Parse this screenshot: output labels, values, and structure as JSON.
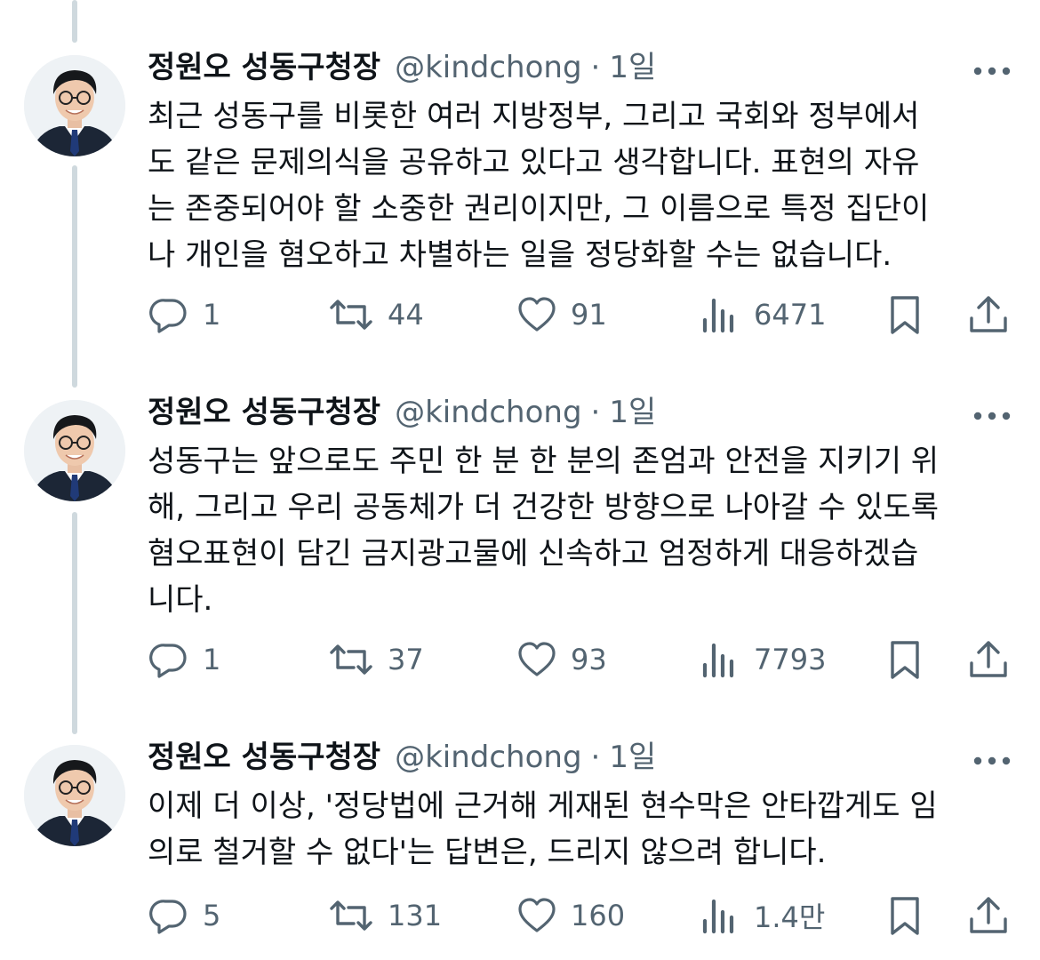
{
  "author": {
    "name": "정원오 성동구청장",
    "handle": "@kindchong",
    "dot": "·",
    "time": "1일"
  },
  "tweets": [
    {
      "lines": [
        "최근 성동구를 비롯한 여러 지방정부, 그리고 국회와 정부에서",
        "도 같은 문제의식을 공유하고 있다고 생각합니다. 표현의 자유",
        "는 존중되어야 할 소중한 권리이지만, 그 이름으로 특정 집단이",
        "나 개인을 혐오하고 차별하는 일을 정당화할 수는 없습니다."
      ],
      "replies": "1",
      "retweets": "44",
      "likes": "91",
      "views": "6471"
    },
    {
      "lines": [
        "성동구는 앞으로도 주민 한 분 한 분의 존엄과 안전을 지키기 위",
        "해, 그리고 우리 공동체가 더 건강한 방향으로 나아갈 수 있도록",
        "혐오표현이 담긴 금지광고물에 신속하고 엄정하게 대응하겠습",
        "니다."
      ],
      "replies": "1",
      "retweets": "37",
      "likes": "93",
      "views": "7793"
    },
    {
      "lines": [
        "이제 더 이상, '정당법에 근거해 게재된 현수막은 안타깝게도 임",
        "의로 철거할 수 없다'는 답변은, 드리지 않으려 합니다."
      ],
      "replies": "5",
      "retweets": "131",
      "likes": "160",
      "views": "1.4만"
    }
  ],
  "icons": {
    "more": "more-horizontal-icon",
    "reply": "reply-bubble-icon",
    "retweet": "retweet-icon",
    "like": "heart-icon",
    "views": "bar-chart-icon",
    "bookmark": "bookmark-icon",
    "share": "share-upload-icon"
  },
  "colors": {
    "text": "#0f1419",
    "secondary": "#536471",
    "thread_line": "#cfd9de"
  }
}
